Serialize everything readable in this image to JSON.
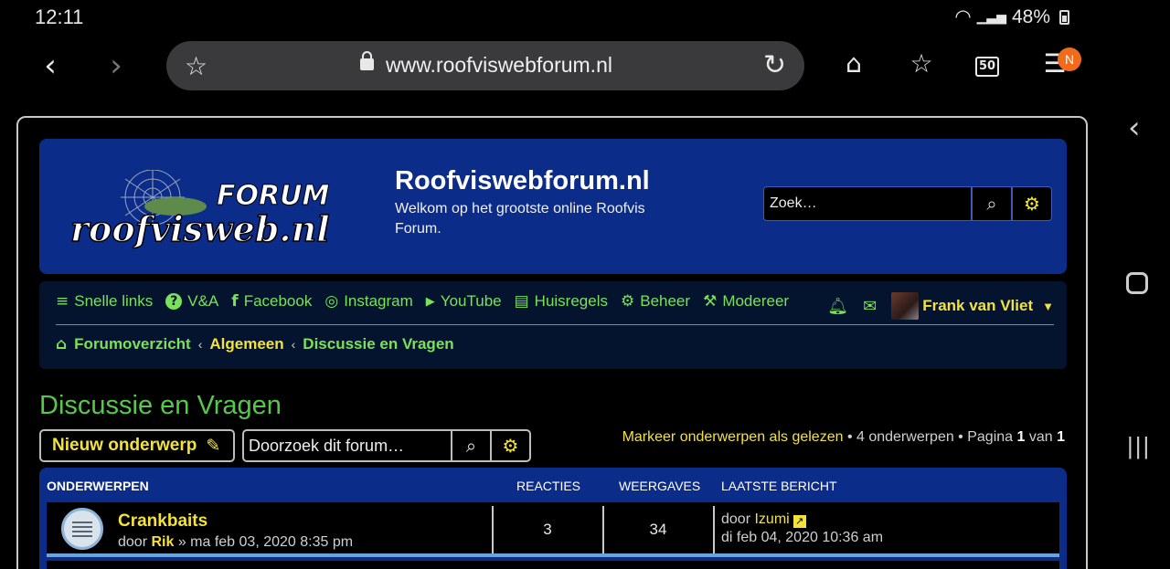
{
  "status": {
    "time": "12:11",
    "battery": "48%"
  },
  "browser": {
    "url": "www.roofviswebforum.nl",
    "tab_count": "50",
    "menu_badge": "N",
    "icons": [
      "back-icon",
      "forward-icon",
      "bookmark-star-icon",
      "lock-icon",
      "reload-icon",
      "home-icon",
      "bookmarks-icon",
      "tabs-icon",
      "menu-icon"
    ]
  },
  "header": {
    "logo_forum": "FORUM",
    "logo_site": "roofvisweb.nl",
    "title": "Roofviswebforum.nl",
    "description": "Welkom op het grootste online Roofvis Forum.",
    "search_placeholder": "Zoek…"
  },
  "nav": {
    "items": [
      {
        "icon": "≡",
        "label": "Snelle links"
      },
      {
        "icon": "?",
        "label": "V&A"
      },
      {
        "icon": "f",
        "label": "Facebook"
      },
      {
        "icon": "◎",
        "label": "Instagram"
      },
      {
        "icon": "▶",
        "label": "YouTube"
      },
      {
        "icon": "▤",
        "label": "Huisregels"
      },
      {
        "icon": "⚙",
        "label": "Beheer"
      },
      {
        "icon": "⚒",
        "label": "Modereer"
      }
    ],
    "user": "Frank van Vliet"
  },
  "breadcrumbs": {
    "home": "Forumoverzicht",
    "level1": "Algemeen",
    "level2": "Discussie en Vragen"
  },
  "forum": {
    "title": "Discussie en Vragen",
    "new_topic": "Nieuw onderwerp",
    "search_placeholder": "Doorzoek dit forum…",
    "mark_read": "Markeer onderwerpen als gelezen",
    "topic_count": " • 4 onderwerpen • Pagina ",
    "page": "1",
    "of": " van ",
    "total_pages": "1"
  },
  "table": {
    "headers": {
      "topics": "ONDERWERPEN",
      "replies": "REACTIES",
      "views": "WEERGAVES",
      "last": "LAATSTE BERICHT"
    },
    "rows": [
      {
        "title": "Crankbaits",
        "by": "door ",
        "author": "Rik",
        "date": " » ma feb 03, 2020 8:35 pm",
        "replies": "3",
        "views": "34",
        "last_by": "door ",
        "last_user": "Izumi",
        "last_date": "di feb 04, 2020 10:36 am"
      }
    ]
  }
}
